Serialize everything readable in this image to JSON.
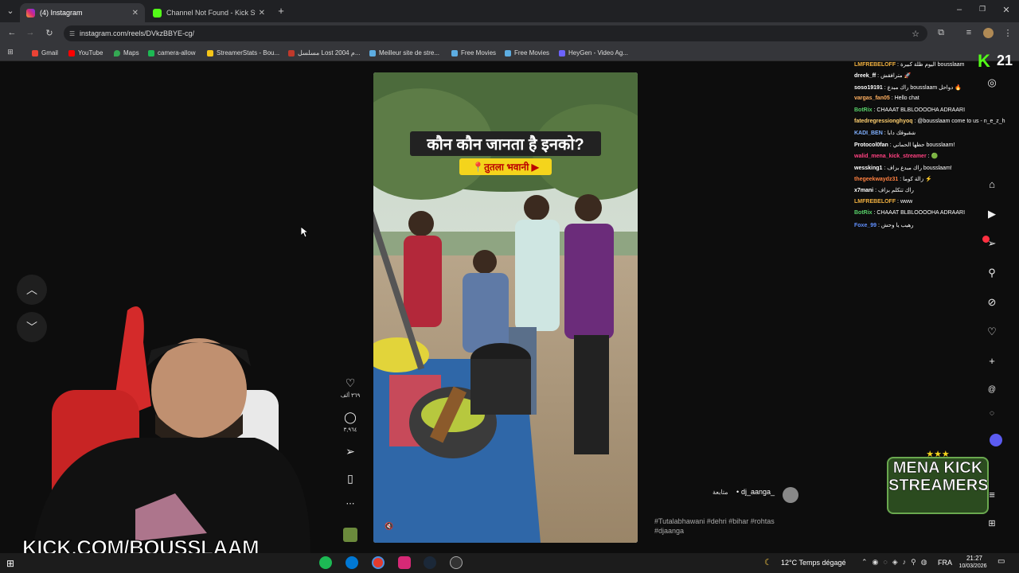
{
  "browser": {
    "tabs": [
      {
        "label": "(4) Instagram",
        "active": true
      },
      {
        "label": "Channel Not Found - Kick Strea",
        "active": false
      }
    ],
    "new_tab": "+",
    "url": "instagram.com/reels/DVkzBBYE-cg/",
    "bookmarks": [
      "Gmail",
      "YouTube",
      "Maps",
      "camera-allow",
      "StreamerStats - Bou...",
      "مسلسل Lost 2004 م...",
      "Meilleur site de stre...",
      "Free Movies",
      "Free Movies",
      "HeyGen - Video Ag..."
    ]
  },
  "reel": {
    "title_overlay": "कौन कौन जानता है इनको?",
    "location_tag": "📍तुतला भवानी ▶",
    "likes": "٣٦٩ ألف",
    "comments": "٣,٩٦٤",
    "author": "dj_aanga_",
    "follow": "متابعة",
    "hashtags_line1": "#Tutalabhawani #dehri #bihar #rohtas",
    "hashtags_line2": "#djaanga"
  },
  "overlay": {
    "kick_count": "21",
    "kick_url": "KICK.COM/BOUSSLAAM",
    "badge_line1": "MENA KICK",
    "badge_line2": "STREAMERS",
    "chat": [
      {
        "user": "LMFREBELOFF",
        "color": "#f0b040",
        "msg": "اليوم ظلة كبيرة bousslaam"
      },
      {
        "user": "dreek_ff",
        "color": "#ffffff",
        "msg": "مترافقش 🚀"
      },
      {
        "user": "soso19191",
        "color": "#ffffff",
        "msg": "راك مبدع bousslaam دواحل 🔥"
      },
      {
        "user": "vargas_fan05",
        "color": "#ffb060",
        "msg": "Hello chat"
      },
      {
        "user": "BotRix",
        "color": "#58d26a",
        "msg": "CHAAAT BLBLOOOOHA ADRAARI"
      },
      {
        "user": "fatedregressionghyoq",
        "color": "#ffd070",
        "msg": "@bousslaam come to us - n_e_z_h"
      },
      {
        "user": "KADI_BEN",
        "color": "#80b0ff",
        "msg": "شقبوقك دابا"
      },
      {
        "user": "Protocol0fan",
        "color": "#ffffff",
        "msg": "حظها الحماني bousslaam!"
      },
      {
        "user": "walid_mena_kick_streamer",
        "color": "#ff4080",
        "msg": "🟢"
      },
      {
        "user": "wessking1",
        "color": "#ffffff",
        "msg": "راك مبدع بزاف bousslaam!"
      },
      {
        "user": "thegeekwaydz31",
        "color": "#ff8040",
        "msg": "زالة كوما ⚡"
      },
      {
        "user": "x7mani",
        "color": "#ffffff",
        "msg": "راك تتكلم بزاف"
      },
      {
        "user": "LMFREBELOFF",
        "color": "#f0b040",
        "msg": "www"
      },
      {
        "user": "BotRix",
        "color": "#58d26a",
        "msg": "CHAAAT BLBLOOOOHA ADRAARI"
      },
      {
        "user": "Foxe_99",
        "color": "#6090ff",
        "msg": "رهيب يا وحش"
      }
    ]
  },
  "taskbar": {
    "weather": "12°C  Temps dégagé",
    "lang": "FRA",
    "time": "21:27",
    "date": "10/03/2026"
  }
}
